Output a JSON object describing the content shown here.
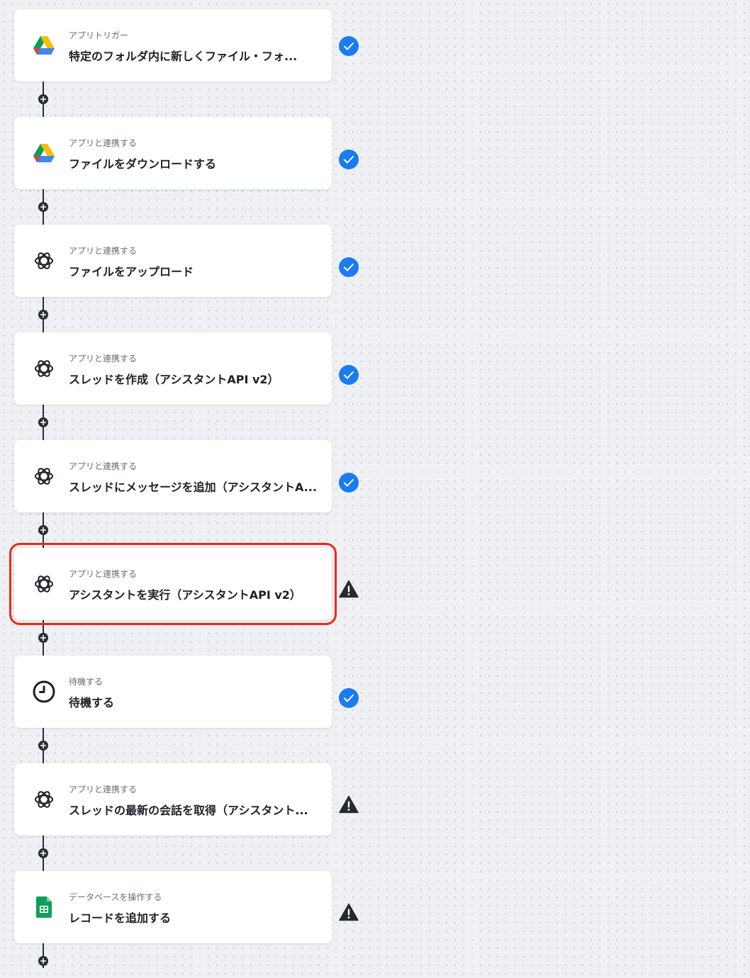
{
  "steps": [
    {
      "subtitle": "アプリトリガー",
      "title": "特定のフォルダ内に新しくファイル・フォ...",
      "icon": "google-drive-icon",
      "status": "success"
    },
    {
      "subtitle": "アプリと連携する",
      "title": "ファイルをダウンロードする",
      "icon": "google-drive-icon",
      "status": "success"
    },
    {
      "subtitle": "アプリと連携する",
      "title": "ファイルをアップロード",
      "icon": "openai-icon",
      "status": "success"
    },
    {
      "subtitle": "アプリと連携する",
      "title": "スレッドを作成（アシスタントAPI v2）",
      "icon": "openai-icon",
      "status": "success"
    },
    {
      "subtitle": "アプリと連携する",
      "title": "スレッドにメッセージを追加（アシスタントA...",
      "icon": "openai-icon",
      "status": "success"
    },
    {
      "subtitle": "アプリと連携する",
      "title": "アシスタントを実行（アシスタントAPI v2）",
      "icon": "openai-icon",
      "status": "warning",
      "selected": true
    },
    {
      "subtitle": "待機する",
      "title": "待機する",
      "icon": "clock-icon",
      "status": "success"
    },
    {
      "subtitle": "アプリと連携する",
      "title": "スレッドの最新の会話を取得（アシスタント...",
      "icon": "openai-icon",
      "status": "warning"
    },
    {
      "subtitle": "データベースを操作する",
      "title": "レコードを追加する",
      "icon": "google-sheets-icon",
      "status": "warning"
    }
  ],
  "colors": {
    "success": "#1a7cf0",
    "warning": "#26292e",
    "selected_outline": "#ee2a12",
    "connector": "#2a2d33"
  }
}
